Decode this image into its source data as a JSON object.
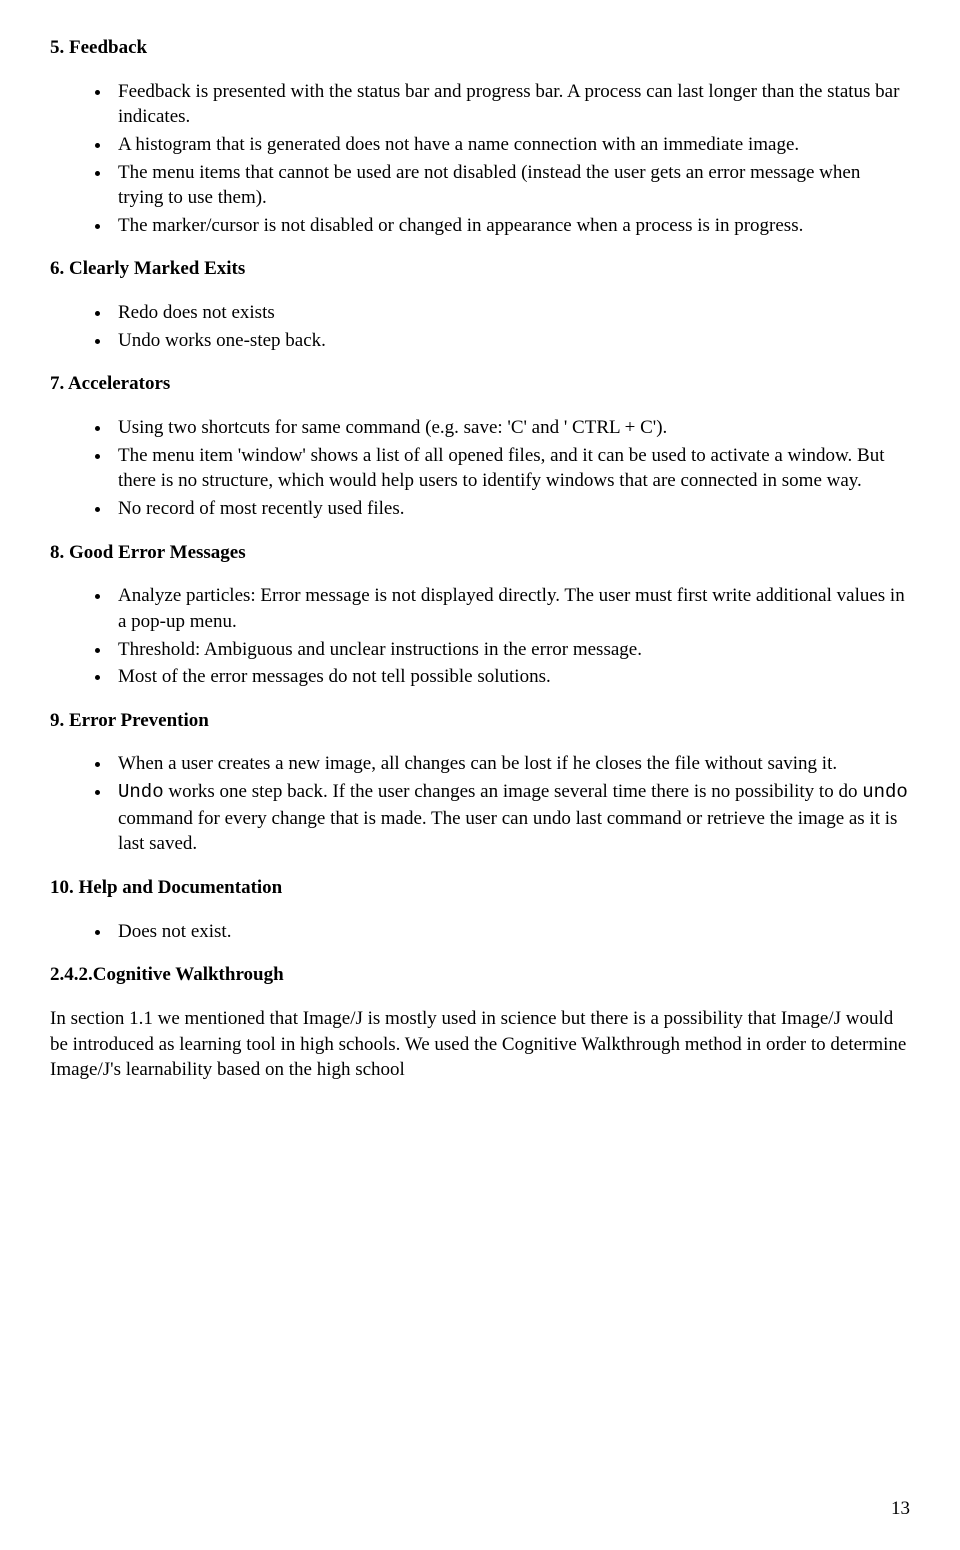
{
  "sections": {
    "s5": {
      "title": "5. Feedback",
      "items": [
        "Feedback is presented with the status bar and progress bar. A process can last longer than the status bar indicates.",
        "A histogram that is generated does not have a name connection with an immediate image.",
        "The menu items that cannot be used are not disabled (instead the user gets an error message when trying to use them).",
        "The marker/cursor is not disabled or changed in appearance when a process is in progress."
      ]
    },
    "s6": {
      "title": "6. Clearly Marked Exits",
      "items": [
        "Redo does not exists",
        "Undo works one-step back."
      ]
    },
    "s7": {
      "title": "7. Accelerators",
      "items": [
        "Using two shortcuts for same command (e.g. save: 'C' and ' CTRL + C').",
        "The menu item 'window' shows a list of all opened files, and it can be used to activate a window. But there is no structure, which would help users to identify windows that are connected in some way.",
        "No record of most recently used files."
      ]
    },
    "s8": {
      "title": "8. Good Error Messages",
      "items": [
        "Analyze particles: Error message is not displayed directly. The user must first write additional values in a pop-up menu.",
        "Threshold: Ambiguous and unclear instructions in the error message.",
        "Most of the error messages do not tell possible solutions."
      ]
    },
    "s9": {
      "title": "9. Error Prevention",
      "items": [
        "When a user creates a new image, all changes can be lost if he closes the file without saving it."
      ],
      "item2_pre": "Undo",
      "item2_mid": " works one step back.  If the user changes an image several time there is no possibility to do ",
      "item2_cmd": "undo",
      "item2_post": "  command for every change that is made. The user can undo last command or retrieve the image as it is last saved."
    },
    "s10": {
      "title": "10. Help and Documentation",
      "items": [
        "Does not exist."
      ]
    }
  },
  "cognitive": {
    "heading": "2.4.2.Cognitive Walkthrough",
    "para": "In section 1.1 we mentioned that Image/J is mostly used in science but there is a possibility that Image/J would be introduced as learning tool in high schools. We used the Cognitive Walkthrough method in order to determine Image/J's learnability based on the high school"
  },
  "page_number": "13"
}
